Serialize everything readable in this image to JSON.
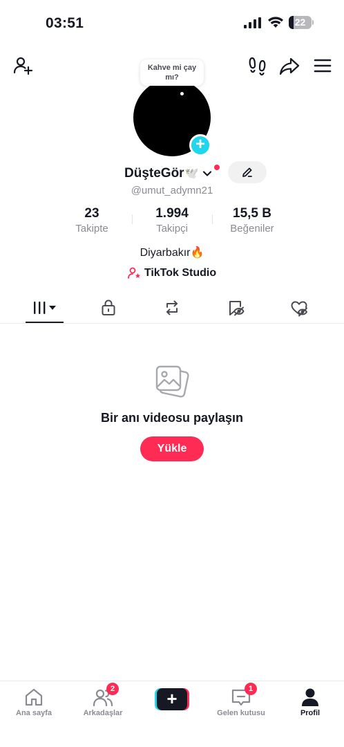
{
  "status_bar": {
    "time": "03:51",
    "battery": "22"
  },
  "header": {
    "icons": [
      "add-friend-icon",
      "footprints-icon",
      "share-icon",
      "menu-icon"
    ]
  },
  "profile": {
    "note": "Kahve mi çay mı?",
    "display_name": "DüşteGör",
    "name_emoji": "🕊️",
    "username": "@umut_adymn21",
    "stats": [
      {
        "value": "23",
        "label": "Takipte"
      },
      {
        "value": "1.994",
        "label": "Takipçi"
      },
      {
        "value": "15,5 B",
        "label": "Beğeniler"
      }
    ],
    "bio": "Diyarbakır🔥",
    "studio_label": "TikTok Studio"
  },
  "tabs": [
    "videos-grid-icon",
    "lock-icon",
    "repost-icon",
    "favorites-icon",
    "liked-icon"
  ],
  "empty_state": {
    "title": "Bir anı videosu paylaşın",
    "button": "Yükle"
  },
  "bottom_nav": {
    "items": [
      {
        "label": "Ana sayfa",
        "icon": "home-icon"
      },
      {
        "label": "Arkadaşlar",
        "icon": "friends-icon",
        "badge": "2"
      },
      {
        "label": "",
        "icon": "create-icon"
      },
      {
        "label": "Gelen kutusu",
        "icon": "inbox-icon",
        "badge": "1"
      },
      {
        "label": "Profil",
        "icon": "profile-icon"
      }
    ]
  },
  "colors": {
    "accent": "#fe2c55",
    "cyan": "#20d5ec",
    "text": "#161823",
    "muted": "#8a8b91"
  }
}
